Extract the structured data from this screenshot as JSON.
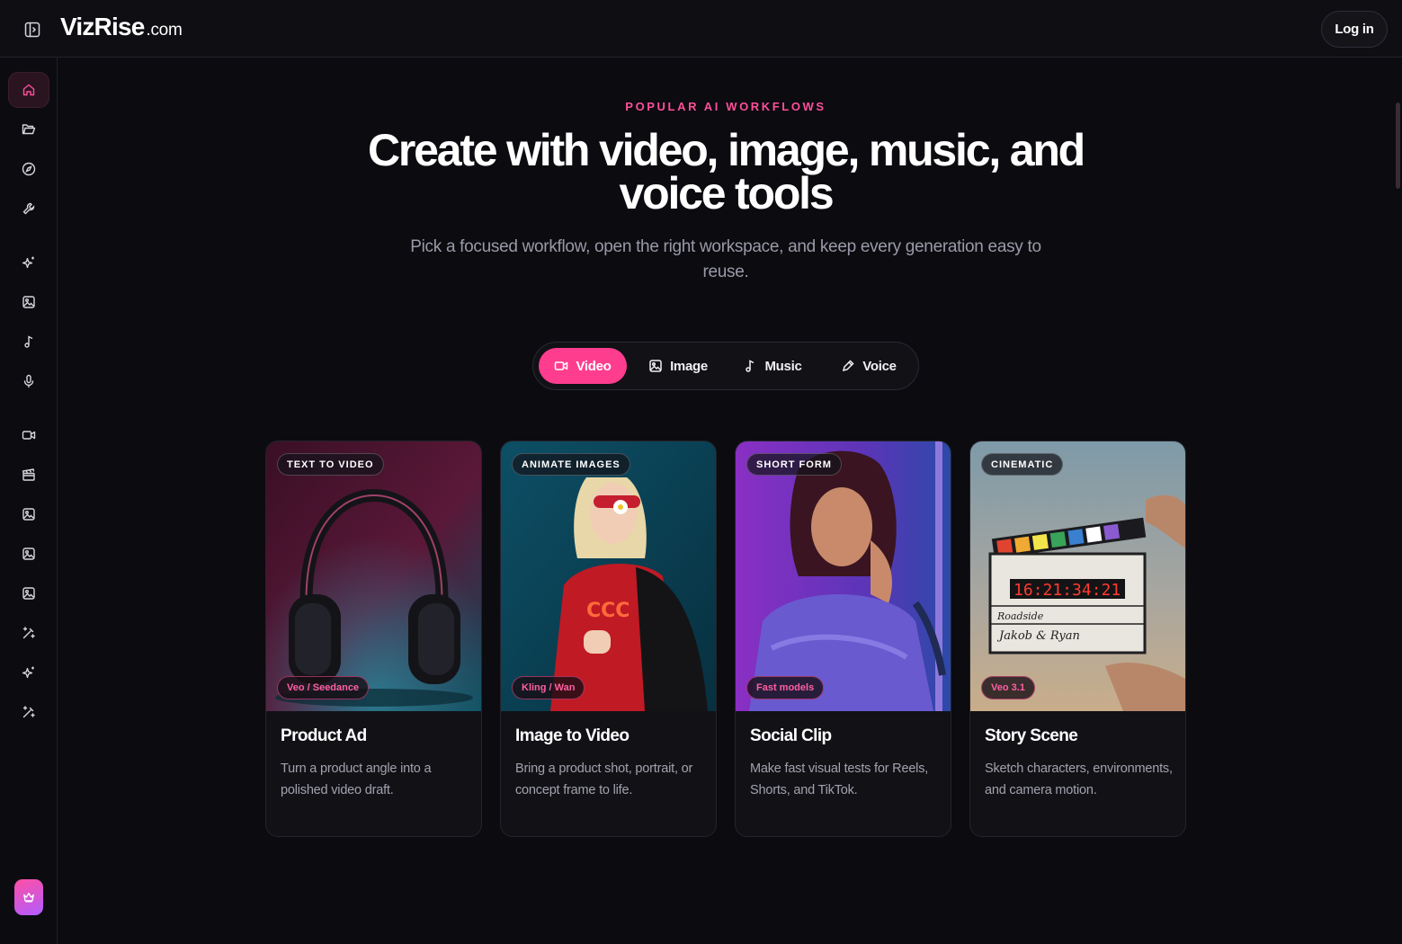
{
  "brand": {
    "name": "VizRise",
    "suffix": ".com"
  },
  "header": {
    "login_label": "Log in"
  },
  "sidebar": {
    "items": [
      {
        "icon": "home-icon"
      },
      {
        "icon": "folder-icon"
      },
      {
        "icon": "compass-icon"
      },
      {
        "icon": "wrench-icon"
      },
      {
        "icon": "sparkles-icon"
      },
      {
        "icon": "image-icon"
      },
      {
        "icon": "music-note-icon"
      },
      {
        "icon": "microphone-icon"
      },
      {
        "icon": "video-camera-icon"
      },
      {
        "icon": "clapperboard-icon"
      },
      {
        "icon": "image-icon"
      },
      {
        "icon": "image-icon"
      },
      {
        "icon": "image-icon"
      },
      {
        "icon": "magic-wand-icon"
      },
      {
        "icon": "sparkles-icon"
      },
      {
        "icon": "magic-wand-icon"
      }
    ],
    "upgrade_icon": "crown-icon"
  },
  "hero": {
    "eyebrow": "POPULAR AI WORKFLOWS",
    "title": "Create with video, image, music, and voice tools",
    "subtitle": "Pick a focused workflow, open the right workspace, and keep every generation easy to reuse."
  },
  "tabs": [
    {
      "label": "Video",
      "icon": "video-camera-icon",
      "active": true
    },
    {
      "label": "Image",
      "icon": "image-icon",
      "active": false
    },
    {
      "label": "Music",
      "icon": "music-note-icon",
      "active": false
    },
    {
      "label": "Voice",
      "icon": "microphone-icon",
      "active": false
    }
  ],
  "cards": [
    {
      "tag": "TEXT TO VIDEO",
      "model": "Veo / Seedance",
      "title": "Product Ad",
      "description": "Turn a product angle into a polished video draft."
    },
    {
      "tag": "ANIMATE IMAGES",
      "model": "Kling / Wan",
      "title": "Image to Video",
      "description": "Bring a product shot, portrait, or concept frame to life."
    },
    {
      "tag": "SHORT FORM",
      "model": "Fast models",
      "title": "Social Clip",
      "description": "Make fast visual tests for Reels, Shorts, and TikTok."
    },
    {
      "tag": "CINEMATIC",
      "model": "Veo 3.1",
      "title": "Story Scene",
      "description": "Sketch characters, environments, and camera motion."
    }
  ],
  "colors": {
    "accent": "#ff3d8e",
    "eyebrow": "#ff4f9a",
    "background": "#0b0b10"
  }
}
